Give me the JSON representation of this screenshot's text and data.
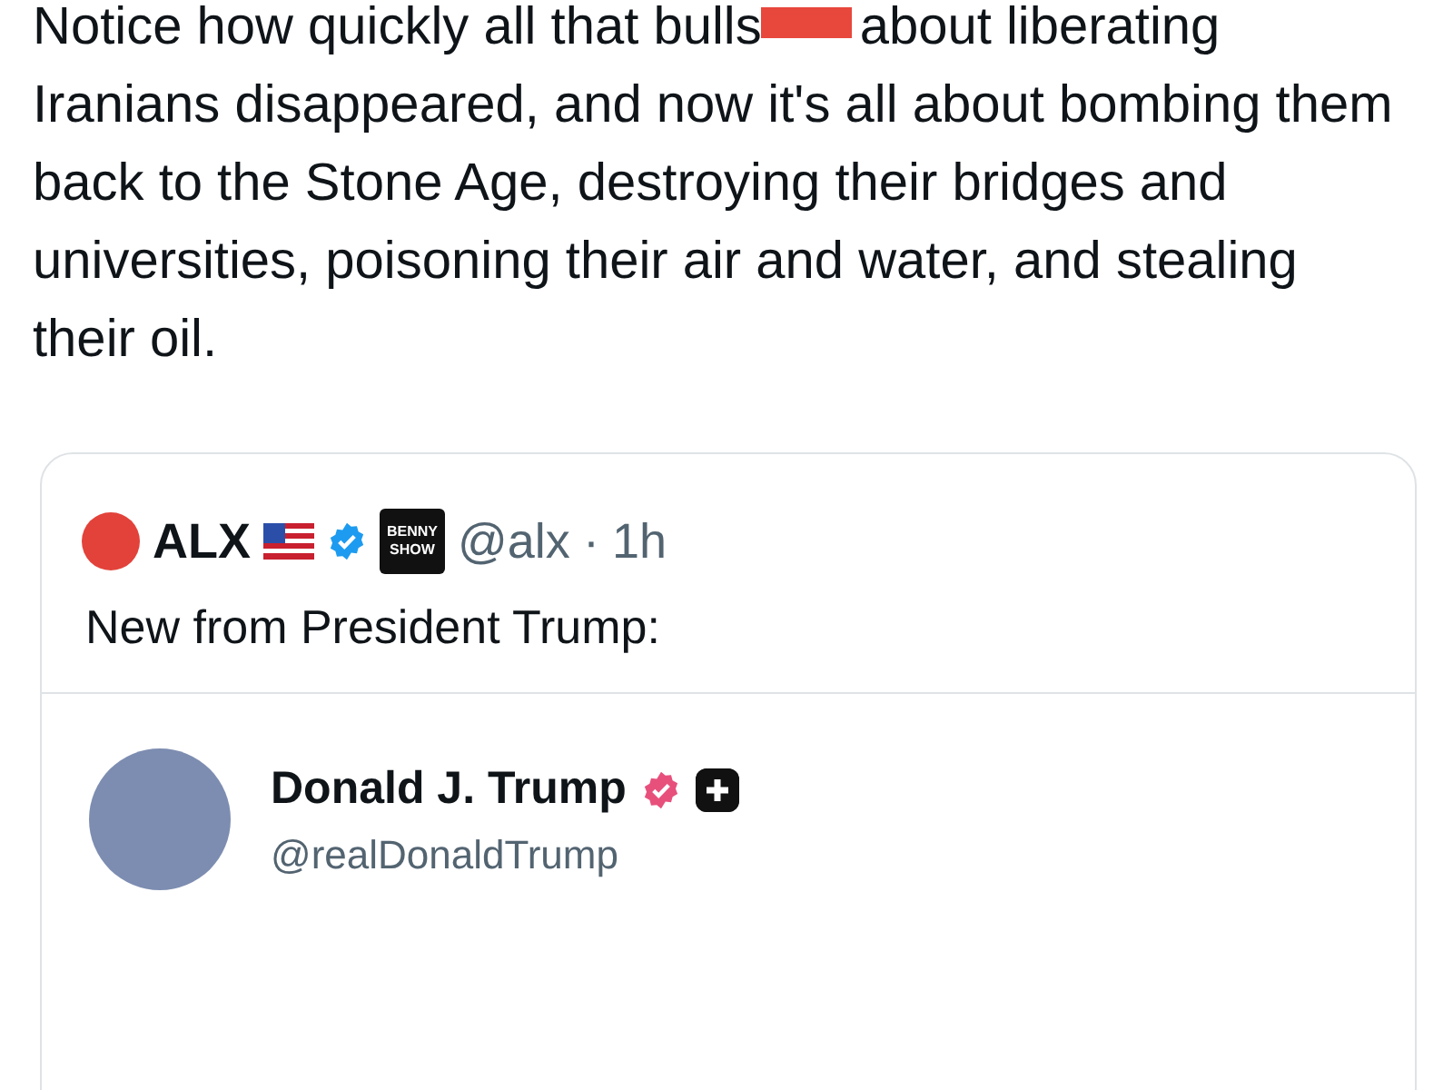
{
  "post": {
    "text_before": "Notice how quickly all that bulls",
    "redacted": true,
    "text_after": "about liberating Iranians disappeared, and now it's all about bombing them back to the Stone Age, destroying their bridges and universities, poisoning their air and water, and stealing their oil."
  },
  "quoted_post": {
    "author": {
      "name": "ALX",
      "verified": true,
      "badge_lines": [
        "BENNY",
        "SHOW"
      ],
      "handle": "@alx",
      "separator": "·",
      "time": "1h"
    },
    "text": "New from President Trump:",
    "embedded": {
      "name": "Donald J. Trump",
      "verified": true,
      "handle": "@realDonaldTrump"
    }
  }
}
